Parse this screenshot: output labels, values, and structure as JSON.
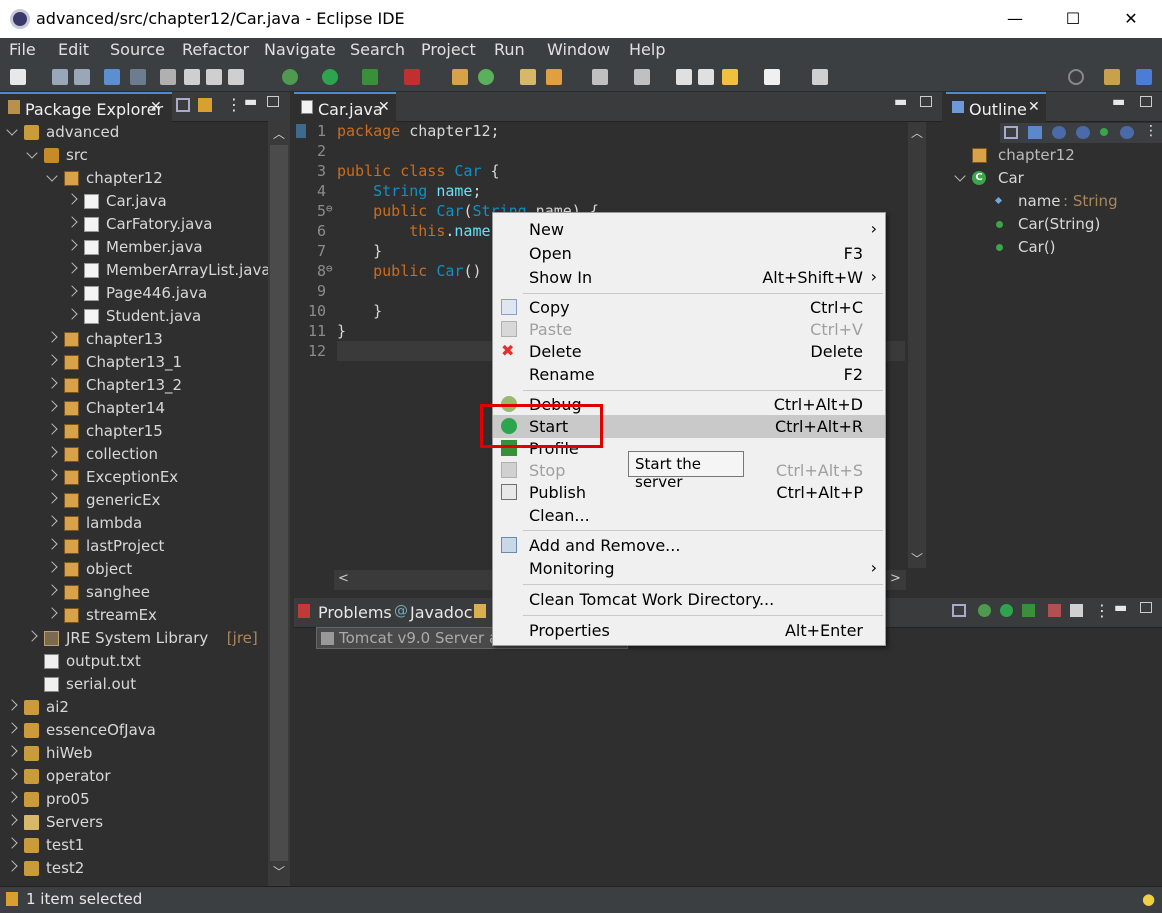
{
  "window": {
    "title": "advanced/src/chapter12/Car.java - Eclipse IDE",
    "minimize": "—",
    "maximize": "☐",
    "close": "✕"
  },
  "menu": [
    "File",
    "Edit",
    "Source",
    "Refactor",
    "Navigate",
    "Search",
    "Project",
    "Run",
    "Window",
    "Help"
  ],
  "package_explorer": {
    "tab_label": "Package Explorer",
    "items": [
      {
        "label": "advanced",
        "twisty": "down",
        "icon": "project-icon"
      },
      {
        "label": "src",
        "twisty": "down",
        "icon": "source-folder-icon"
      },
      {
        "label": "chapter12",
        "twisty": "down",
        "icon": "package-icon"
      },
      {
        "label": "Car.java",
        "twisty": "right",
        "icon": "java-file-icon"
      },
      {
        "label": "CarFatory.java",
        "twisty": "right",
        "icon": "java-file-icon"
      },
      {
        "label": "Member.java",
        "twisty": "right",
        "icon": "java-file-icon"
      },
      {
        "label": "MemberArrayList.java",
        "twisty": "right",
        "icon": "java-file-icon"
      },
      {
        "label": "Page446.java",
        "twisty": "right",
        "icon": "java-file-icon"
      },
      {
        "label": "Student.java",
        "twisty": "right",
        "icon": "java-file-icon"
      },
      {
        "label": "chapter13",
        "twisty": "right",
        "icon": "package-icon"
      },
      {
        "label": "Chapter13_1",
        "twisty": "right",
        "icon": "package-icon"
      },
      {
        "label": "Chapter13_2",
        "twisty": "right",
        "icon": "package-icon"
      },
      {
        "label": "Chapter14",
        "twisty": "right",
        "icon": "package-icon"
      },
      {
        "label": "chapter15",
        "twisty": "right",
        "icon": "package-icon"
      },
      {
        "label": "collection",
        "twisty": "right",
        "icon": "package-icon"
      },
      {
        "label": "ExceptionEx",
        "twisty": "right",
        "icon": "package-icon"
      },
      {
        "label": "genericEx",
        "twisty": "right",
        "icon": "package-icon"
      },
      {
        "label": "lambda",
        "twisty": "right",
        "icon": "package-icon"
      },
      {
        "label": "lastProject",
        "twisty": "right",
        "icon": "package-icon"
      },
      {
        "label": "object",
        "twisty": "right",
        "icon": "package-icon"
      },
      {
        "label": "sanghee",
        "twisty": "right",
        "icon": "package-icon"
      },
      {
        "label": "streamEx",
        "twisty": "right",
        "icon": "package-icon"
      },
      {
        "label": "JRE System Library",
        "suffix": "[jre]",
        "twisty": "right",
        "icon": "library-icon"
      },
      {
        "label": "output.txt",
        "twisty": "none",
        "icon": "text-file-icon"
      },
      {
        "label": "serial.out",
        "twisty": "none",
        "icon": "text-file-icon"
      },
      {
        "label": "ai2",
        "twisty": "right",
        "icon": "project-icon"
      },
      {
        "label": "essenceOfJava",
        "twisty": "right",
        "icon": "project-icon"
      },
      {
        "label": "hiWeb",
        "twisty": "right",
        "icon": "project-icon"
      },
      {
        "label": "operator",
        "twisty": "right",
        "icon": "project-icon"
      },
      {
        "label": "pro05",
        "twisty": "right",
        "icon": "project-icon"
      },
      {
        "label": "Servers",
        "twisty": "right",
        "icon": "folder-icon"
      },
      {
        "label": "test1",
        "twisty": "right",
        "icon": "project-icon"
      },
      {
        "label": "test2",
        "twisty": "right",
        "icon": "project-icon"
      }
    ]
  },
  "editor": {
    "tab_label": "Car.java",
    "line_numbers": [
      "1",
      "2",
      "3",
      "4",
      "5",
      "6",
      "7",
      "8",
      "9",
      "10",
      "11",
      "12"
    ],
    "fold_markers": {
      "5": "⊖",
      "8": "⊖"
    }
  },
  "outline": {
    "tab_label": "Outline",
    "items": [
      {
        "label": "chapter12",
        "type": ""
      },
      {
        "label": "Car",
        "type": ""
      },
      {
        "label": "name",
        "type": " : String"
      },
      {
        "label": "Car(String)",
        "type": ""
      },
      {
        "label": "Car()",
        "type": ""
      }
    ]
  },
  "bottom": {
    "tabs": [
      "Problems",
      "Javadoc"
    ],
    "server_row": "Tomcat v9.0 Server at l"
  },
  "context_menu": {
    "items": [
      {
        "label": "New",
        "shortcut": "",
        "submenu": true,
        "icon": ""
      },
      {
        "label": "Open",
        "shortcut": "F3",
        "submenu": false,
        "icon": ""
      },
      {
        "label": "Show In",
        "shortcut": "Alt+Shift+W",
        "submenu": true,
        "icon": ""
      },
      {
        "sep": true
      },
      {
        "label": "Copy",
        "shortcut": "Ctrl+C",
        "icon": "copy-icon"
      },
      {
        "label": "Paste",
        "shortcut": "Ctrl+V",
        "icon": "paste-icon",
        "disabled": true
      },
      {
        "label": "Delete",
        "shortcut": "Delete",
        "icon": "delete-icon"
      },
      {
        "label": "Rename",
        "shortcut": "F2",
        "icon": ""
      },
      {
        "sep": true
      },
      {
        "label": "Debug",
        "shortcut": "Ctrl+Alt+D",
        "icon": "debug-icon"
      },
      {
        "label": "Start",
        "shortcut": "Ctrl+Alt+R",
        "icon": "start-icon",
        "highlighted": true
      },
      {
        "label": "Profile",
        "shortcut": "",
        "icon": "profile-icon"
      },
      {
        "label": "Stop",
        "shortcut": "Ctrl+Alt+S",
        "icon": "stop-icon",
        "disabled": true
      },
      {
        "label": "Publish",
        "shortcut": "Ctrl+Alt+P",
        "icon": "publish-icon"
      },
      {
        "label": "Clean...",
        "shortcut": "",
        "icon": ""
      },
      {
        "sep": true
      },
      {
        "label": "Add and Remove...",
        "shortcut": "",
        "icon": "add-remove-icon"
      },
      {
        "label": "Monitoring",
        "shortcut": "",
        "submenu": true,
        "icon": ""
      },
      {
        "sep": true
      },
      {
        "label": "Clean Tomcat Work Directory...",
        "shortcut": "",
        "icon": ""
      },
      {
        "sep": true
      },
      {
        "label": "Properties",
        "shortcut": "Alt+Enter",
        "icon": ""
      }
    ]
  },
  "tooltip": "Start the server",
  "status": "1 item selected",
  "colors": {
    "keyword": "#cc6c1d",
    "type": "#1290c3",
    "field": "#66e1f8",
    "highlight": "#e00000"
  }
}
